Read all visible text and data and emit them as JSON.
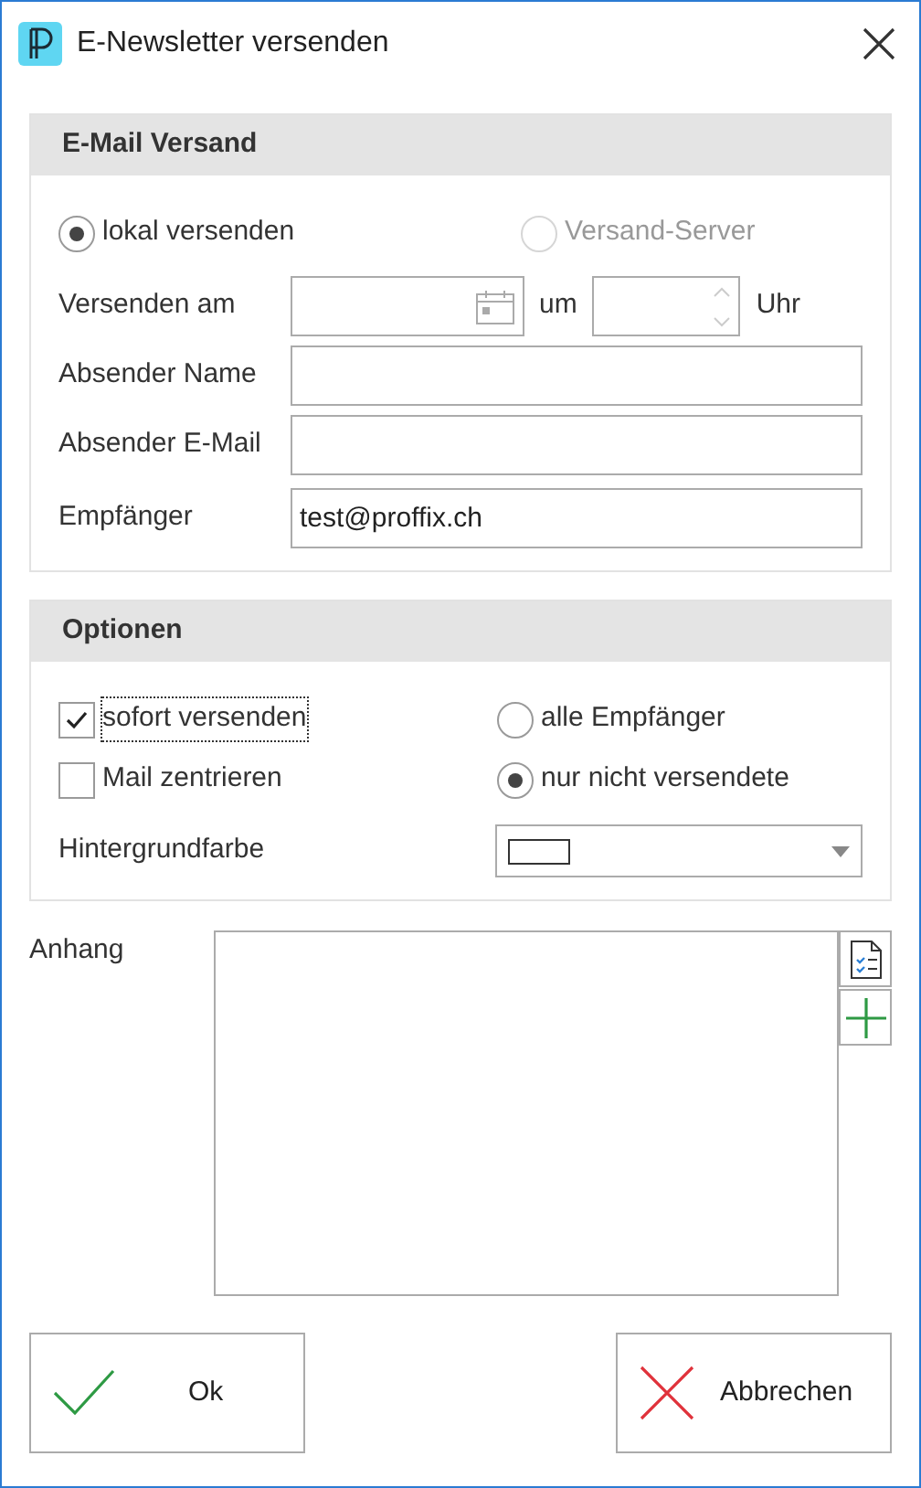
{
  "window": {
    "title": "E-Newsletter versenden"
  },
  "email_group": {
    "title": "E-Mail Versand",
    "send_modes": [
      {
        "label": "lokal versenden",
        "selected": true,
        "disabled": false
      },
      {
        "label": "Versand-Server",
        "selected": false,
        "disabled": true
      }
    ],
    "schedule": {
      "label": "Versenden am",
      "at_label": "um",
      "unit_label": "Uhr"
    },
    "fields": [
      {
        "label": "Absender Name"
      },
      {
        "label": "Absender E-Mail"
      },
      {
        "label": "Empfänger",
        "value": "test@proffix.ch"
      }
    ]
  },
  "options_group": {
    "title": "Optionen",
    "checkboxes": [
      {
        "label": "sofort versenden",
        "checked": true,
        "focused": true
      },
      {
        "label": "Mail zentrieren",
        "checked": false,
        "focused": false
      }
    ],
    "recipients": [
      {
        "label": "alle Empfänger",
        "selected": false
      },
      {
        "label": "nur nicht versendete",
        "selected": true
      }
    ],
    "background": {
      "label": "Hintergrundfarbe",
      "color": "#ffffff"
    }
  },
  "attachment": {
    "label": "Anhang"
  },
  "buttons": [
    {
      "label": "Ok",
      "kind": "ok"
    },
    {
      "label": "Abbrechen",
      "kind": "cancel"
    }
  ]
}
